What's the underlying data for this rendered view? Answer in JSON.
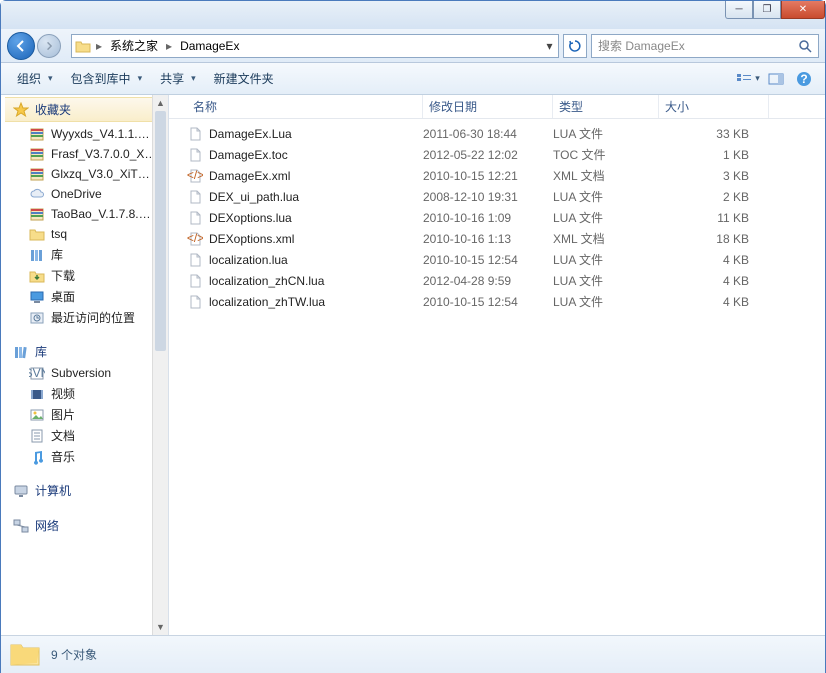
{
  "window": {
    "minimize": "─",
    "maximize": "❐",
    "close": "✕"
  },
  "breadcrumb": {
    "items": [
      "系统之家",
      "DamageEx"
    ]
  },
  "search": {
    "placeholder": "搜索 DamageEx"
  },
  "toolbar": {
    "organize": "组织",
    "include": "包含到库中",
    "share": "共享",
    "new_folder": "新建文件夹"
  },
  "sidebar": {
    "favorites": {
      "label": "收藏夹",
      "items": [
        {
          "icon": "archive",
          "label": "Wyyxds_V4.1.1.…"
        },
        {
          "icon": "archive",
          "label": "Frasf_V3.7.0.0_X…"
        },
        {
          "icon": "archive",
          "label": "Glxzq_V3.0_XiT…"
        },
        {
          "icon": "cloud",
          "label": "OneDrive"
        },
        {
          "icon": "archive",
          "label": "TaoBao_V.1.7.8.…"
        },
        {
          "icon": "folder",
          "label": "tsq"
        },
        {
          "icon": "library",
          "label": "库"
        },
        {
          "icon": "download",
          "label": "下载"
        },
        {
          "icon": "desktop",
          "label": "桌面"
        },
        {
          "icon": "recent",
          "label": "最近访问的位置"
        }
      ]
    },
    "libraries": {
      "label": "库",
      "items": [
        {
          "icon": "svn",
          "label": "Subversion"
        },
        {
          "icon": "video",
          "label": "视频"
        },
        {
          "icon": "picture",
          "label": "图片"
        },
        {
          "icon": "document",
          "label": "文档"
        },
        {
          "icon": "music",
          "label": "音乐"
        }
      ]
    },
    "computer": {
      "label": "计算机"
    },
    "network": {
      "label": "网络"
    }
  },
  "columns": {
    "name": "名称",
    "date": "修改日期",
    "type": "类型",
    "size": "大小"
  },
  "files": [
    {
      "name": "DamageEx.Lua",
      "date": "2011-06-30 18:44",
      "type": "LUA 文件",
      "size": "33 KB",
      "icon": "file"
    },
    {
      "name": "DamageEx.toc",
      "date": "2012-05-22 12:02",
      "type": "TOC 文件",
      "size": "1 KB",
      "icon": "file"
    },
    {
      "name": "DamageEx.xml",
      "date": "2010-10-15 12:21",
      "type": "XML 文档",
      "size": "3 KB",
      "icon": "xml"
    },
    {
      "name": "DEX_ui_path.lua",
      "date": "2008-12-10 19:31",
      "type": "LUA 文件",
      "size": "2 KB",
      "icon": "file"
    },
    {
      "name": "DEXoptions.lua",
      "date": "2010-10-16 1:09",
      "type": "LUA 文件",
      "size": "11 KB",
      "icon": "file"
    },
    {
      "name": "DEXoptions.xml",
      "date": "2010-10-16 1:13",
      "type": "XML 文档",
      "size": "18 KB",
      "icon": "xml"
    },
    {
      "name": "localization.lua",
      "date": "2010-10-15 12:54",
      "type": "LUA 文件",
      "size": "4 KB",
      "icon": "file"
    },
    {
      "name": "localization_zhCN.lua",
      "date": "2012-04-28 9:59",
      "type": "LUA 文件",
      "size": "4 KB",
      "icon": "file"
    },
    {
      "name": "localization_zhTW.lua",
      "date": "2010-10-15 12:54",
      "type": "LUA 文件",
      "size": "4 KB",
      "icon": "file"
    }
  ],
  "status": {
    "count": "9 个对象"
  }
}
